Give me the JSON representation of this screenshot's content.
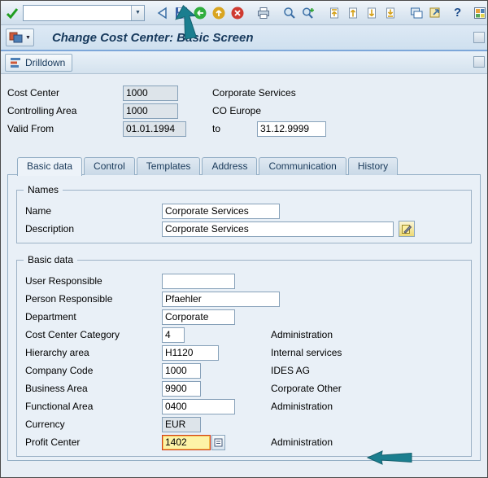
{
  "toolbar": {
    "command_value": "",
    "icons": [
      "enter",
      "command-field",
      "back",
      "save",
      "undo",
      "exit",
      "cancel",
      "print",
      "find",
      "find-next",
      "first-page",
      "page-up",
      "page-down",
      "last-page",
      "new-session",
      "create-shortcut",
      "help",
      "customize"
    ]
  },
  "titlebar": {
    "title": "Change Cost Center: Basic Screen"
  },
  "appbar": {
    "drilldown_label": "Drilldown"
  },
  "header": {
    "rows": [
      {
        "label": "Cost Center",
        "value": "1000",
        "text": "Corporate Services"
      },
      {
        "label": "Controlling Area",
        "value": "1000",
        "text": "CO Europe"
      },
      {
        "label": "Valid From",
        "value": "01.01.1994",
        "to_label": "to",
        "to_value": "31.12.9999"
      }
    ]
  },
  "tabs": [
    {
      "label": "Basic data",
      "active": true
    },
    {
      "label": "Control",
      "active": false
    },
    {
      "label": "Templates",
      "active": false
    },
    {
      "label": "Address",
      "active": false
    },
    {
      "label": "Communication",
      "active": false
    },
    {
      "label": "History",
      "active": false
    }
  ],
  "names_group": {
    "title": "Names",
    "rows": [
      {
        "label": "Name",
        "value": "Corporate Services"
      },
      {
        "label": "Description",
        "value": "Corporate Services"
      }
    ]
  },
  "basic_group": {
    "title": "Basic data",
    "rows": [
      {
        "label": "User Responsible",
        "value": "",
        "text": ""
      },
      {
        "label": "Person Responsible",
        "value": "Pfaehler",
        "text": ""
      },
      {
        "label": "Department",
        "value": "Corporate",
        "text": ""
      },
      {
        "label": "Cost Center Category",
        "value": "4",
        "text": "Administration"
      },
      {
        "label": "Hierarchy area",
        "value": "H1120",
        "text": "Internal services"
      },
      {
        "label": "Company Code",
        "value": "1000",
        "text": "IDES AG"
      },
      {
        "label": "Business Area",
        "value": "9900",
        "text": "Corporate Other"
      },
      {
        "label": "Functional Area",
        "value": "0400",
        "text": "Administration"
      },
      {
        "label": "Currency",
        "value": "EUR",
        "text": ""
      },
      {
        "label": "Profit Center",
        "value": "1402",
        "text": "Administration"
      }
    ]
  },
  "colors": {
    "annotation_arrow": "#1b7e8f",
    "field_highlight_bg": "#fdf3a7",
    "field_highlight_border": "#d23c1e"
  }
}
